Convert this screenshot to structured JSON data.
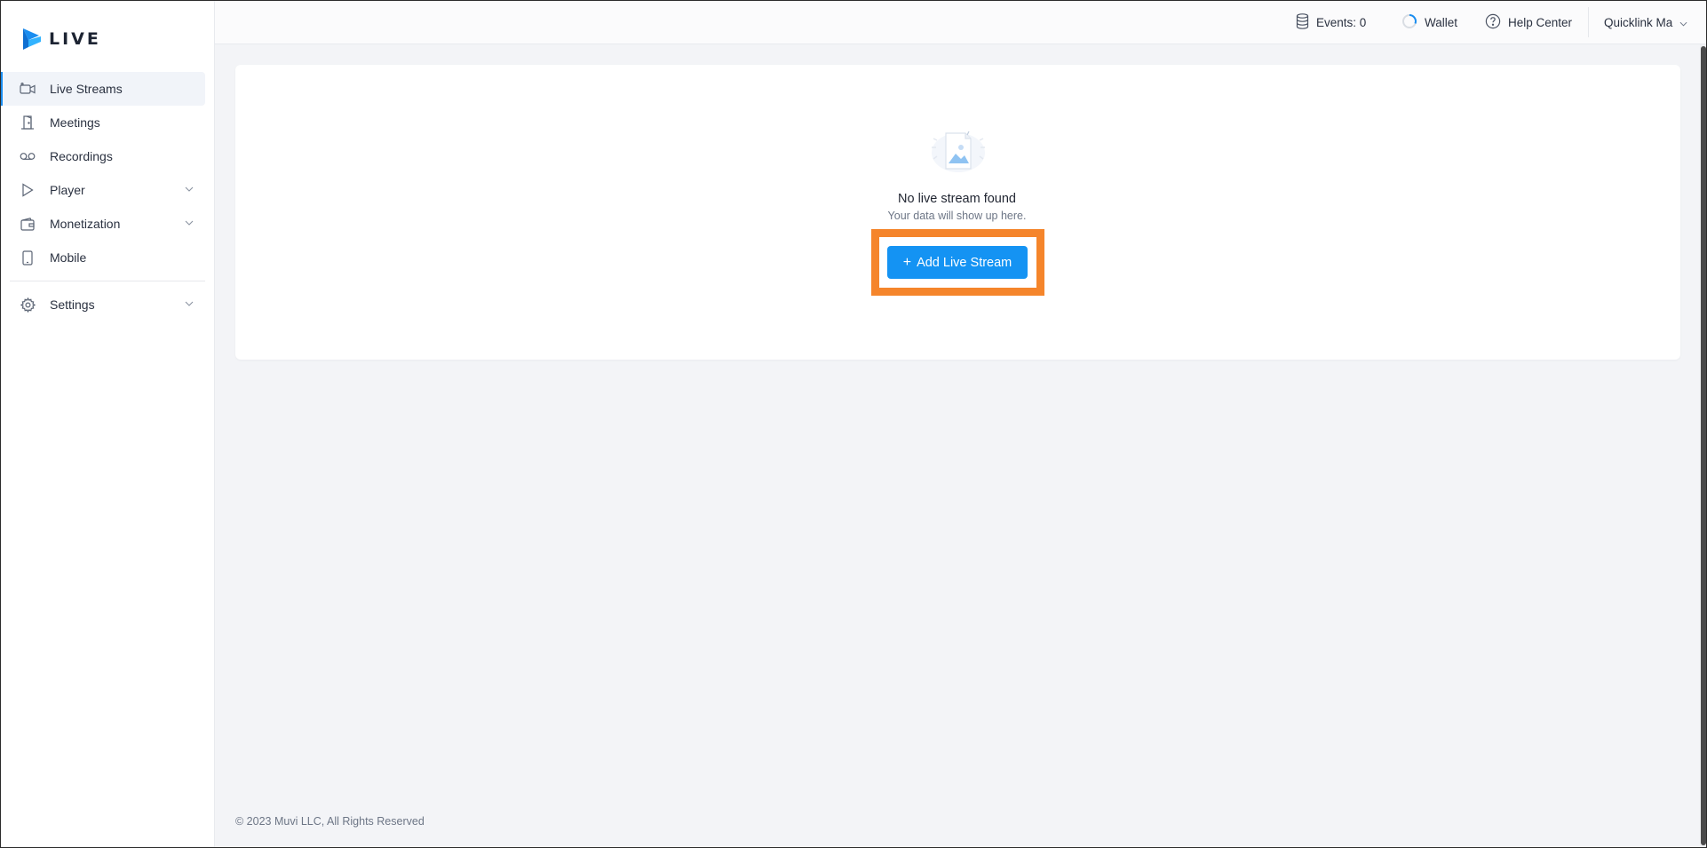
{
  "brand": {
    "logo_text": "LIVE",
    "accent_color": "#1a8df0",
    "highlight_color": "#f5852b"
  },
  "sidebar": {
    "items": [
      {
        "label": "Live Streams",
        "icon": "video-camera-icon",
        "active": true
      },
      {
        "label": "Meetings",
        "icon": "door-icon"
      },
      {
        "label": "Recordings",
        "icon": "voicemail-icon"
      },
      {
        "label": "Player",
        "icon": "play-icon",
        "has_submenu": true
      },
      {
        "label": "Monetization",
        "icon": "wallet-icon",
        "has_submenu": true
      },
      {
        "label": "Mobile",
        "icon": "mobile-icon"
      }
    ],
    "settings": {
      "label": "Settings",
      "icon": "gear-icon",
      "has_submenu": true
    }
  },
  "topbar": {
    "events_label": "Events: 0",
    "wallet_label": "Wallet",
    "help_label": "Help Center",
    "account_label": "Quicklink Ma"
  },
  "main": {
    "empty_title": "No live stream found",
    "empty_subtitle": "Your data will show up here.",
    "add_button_plus": "+",
    "add_button_label": "Add Live Stream"
  },
  "footer": {
    "copyright": "© 2023 Muvi LLC, All Rights Reserved"
  }
}
